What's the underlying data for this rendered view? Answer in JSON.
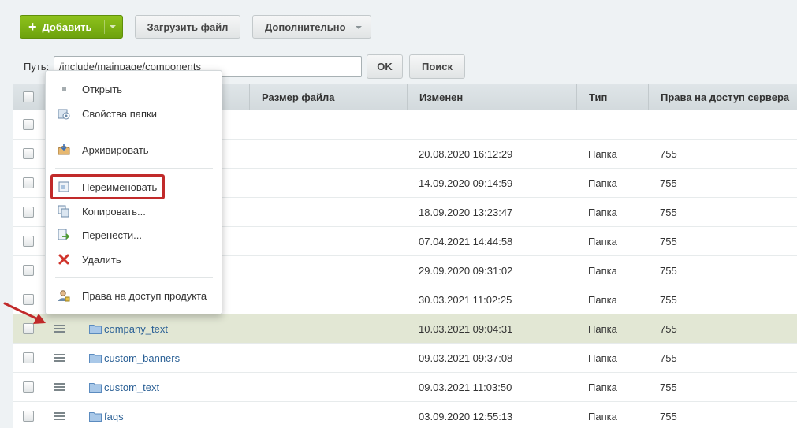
{
  "toolbar": {
    "add_label": "Добавить",
    "upload_label": "Загрузить файл",
    "more_label": "Дополнительно"
  },
  "pathbar": {
    "label": "Путь:",
    "path_value": "/include/mainpage/components",
    "ok_label": "OK",
    "search_label": "Поиск"
  },
  "grid": {
    "headers": [
      "Размер файла",
      "Изменен",
      "Тип",
      "Права на доступ сервера"
    ],
    "rows": [
      {
        "name": "",
        "date": "",
        "type": "",
        "perm": ""
      },
      {
        "name": "",
        "date": "20.08.2020 16:12:29",
        "type": "Папка",
        "perm": "755"
      },
      {
        "name": "",
        "date": "14.09.2020 09:14:59",
        "type": "Папка",
        "perm": "755"
      },
      {
        "name": "",
        "date": "18.09.2020 13:23:47",
        "type": "Папка",
        "perm": "755"
      },
      {
        "name": "",
        "date": "07.04.2021 14:44:58",
        "type": "Папка",
        "perm": "755"
      },
      {
        "name": "",
        "date": "29.09.2020 09:31:02",
        "type": "Папка",
        "perm": "755"
      },
      {
        "name": "",
        "date": "30.03.2021 11:02:25",
        "type": "Папка",
        "perm": "755"
      },
      {
        "name": "company_text",
        "date": "10.03.2021 09:04:31",
        "type": "Папка",
        "perm": "755"
      },
      {
        "name": "custom_banners",
        "date": "09.03.2021 09:37:08",
        "type": "Папка",
        "perm": "755"
      },
      {
        "name": "custom_text",
        "date": "09.03.2021 11:03:50",
        "type": "Папка",
        "perm": "755"
      },
      {
        "name": "faqs",
        "date": "03.09.2020 12:55:13",
        "type": "Папка",
        "perm": "755"
      }
    ]
  },
  "context_menu": {
    "items": [
      {
        "label": "Открыть",
        "icon": "open-dot-icon"
      },
      {
        "label": "Свойства папки",
        "icon": "folder-properties-icon"
      },
      {
        "label": "Архивировать",
        "icon": "archive-icon"
      },
      {
        "label": "Переименовать",
        "icon": "rename-icon"
      },
      {
        "label": "Копировать...",
        "icon": "copy-icon"
      },
      {
        "label": "Перенести...",
        "icon": "move-icon"
      },
      {
        "label": "Удалить",
        "icon": "delete-icon"
      },
      {
        "label": "Права на доступ продукта",
        "icon": "product-access-icon"
      }
    ]
  },
  "colors": {
    "accent_green": "#7cb518",
    "highlight_row": "#e2e7d4",
    "annotation_red": "#c12a2a",
    "link_blue": "#2c6196"
  }
}
